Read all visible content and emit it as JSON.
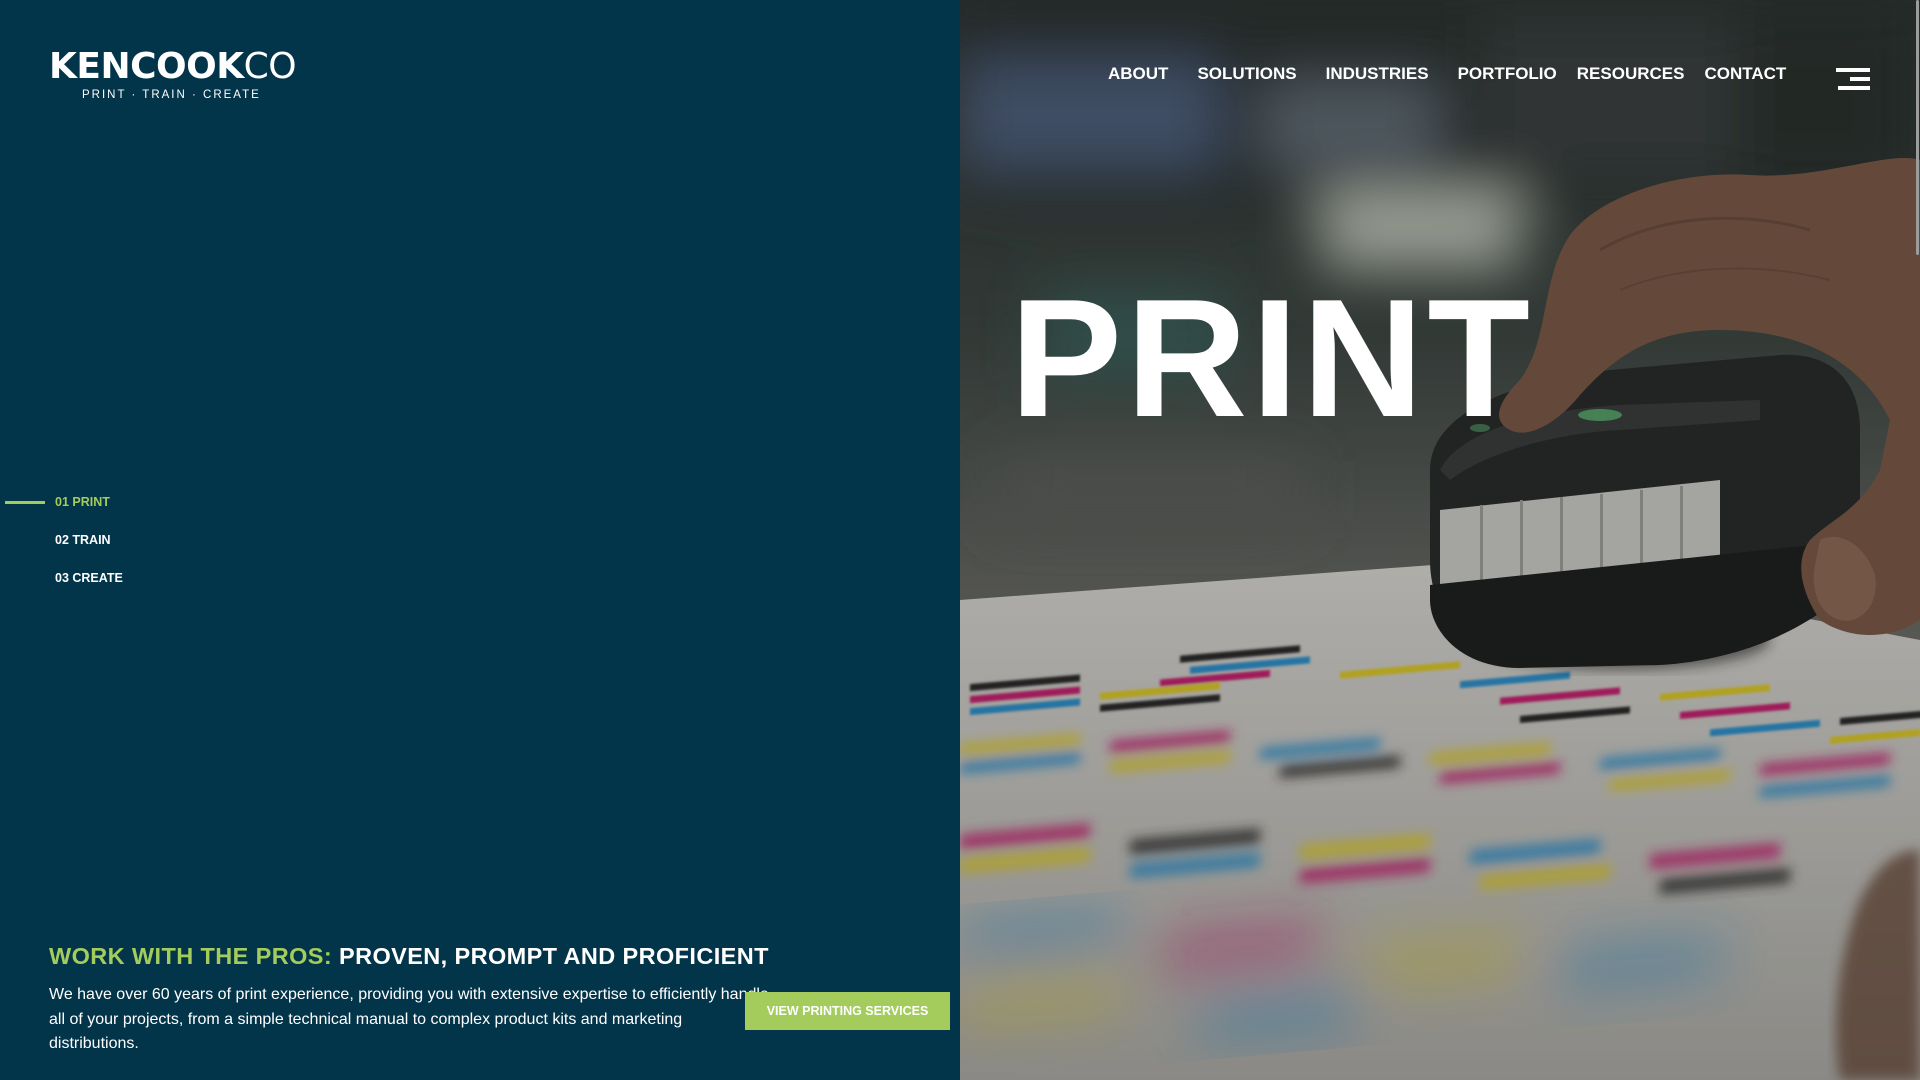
{
  "brand": {
    "name_bold": "KENCOOK",
    "name_light": "CO",
    "tagline": "PRINT · TRAIN · CREATE"
  },
  "nav": {
    "about": "ABOUT",
    "solutions": "SOLUTIONS",
    "industries": "INDUSTRIES",
    "portfolio": "PORTFOLIO",
    "resources": "RESOURCES",
    "contact": "CONTACT"
  },
  "menu_icon": "hamburger-menu-icon",
  "hero": {
    "title": "PRINT"
  },
  "slides": [
    {
      "label": "01 PRINT",
      "active": true
    },
    {
      "label": "02 TRAIN",
      "active": false
    },
    {
      "label": "03 CREATE",
      "active": false
    }
  ],
  "section": {
    "headline_accent": "WORK WITH THE PROS:",
    "headline_rest": "PROVEN, PROMPT AND PROFICIENT",
    "body": "We have over 60 years of print experience, providing you with extensive expertise to efficiently handle all of your projects, from a simple technical manual to complex product kits and marketing distributions.",
    "cta_label": "VIEW PRINTING SERVICES"
  },
  "colors": {
    "panel_bg": "#02344a",
    "accent": "#a4cc5d",
    "text": "#ffffff"
  }
}
